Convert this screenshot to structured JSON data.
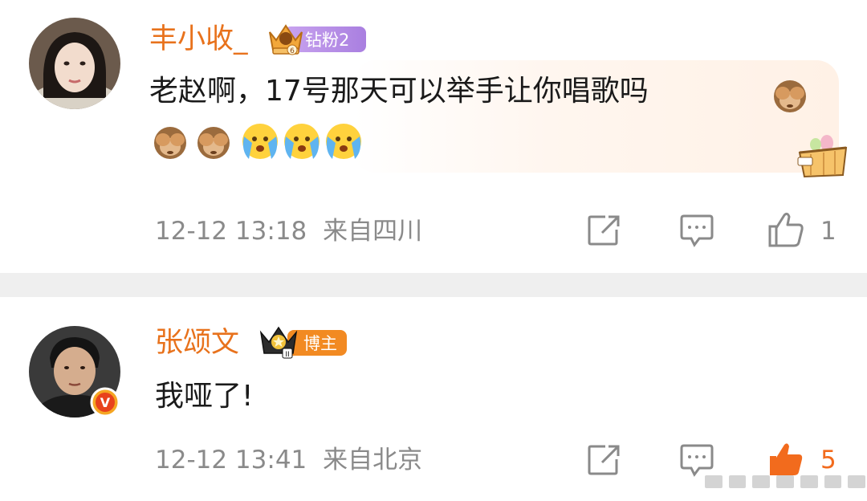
{
  "comments": [
    {
      "user": {
        "name": "丰小收_",
        "badge_level": "6",
        "badge_label": "钻粉2"
      },
      "text_line1": "老赵啊，17号那天可以举手让你唱歌吗",
      "meta": {
        "time": "12-12 13:18",
        "location": "来自四川"
      },
      "like_count": "1",
      "emojis": [
        "see-no-evil-monkey",
        "see-no-evil-monkey",
        "see-no-evil-monkey",
        "crying-face",
        "crying-face",
        "crying-face"
      ]
    },
    {
      "user": {
        "name": "张颂文",
        "badge_level": "II",
        "badge_label": "博主",
        "verified_mark": "V"
      },
      "text": "我哑了!",
      "meta": {
        "time": "12-12 13:41",
        "location": "来自北京"
      },
      "like_count": "5"
    }
  ],
  "colors": {
    "name": "#e8721c",
    "fan_badge": "#b48ae8",
    "blogger_badge": "#f28a22",
    "like_active": "#f26b1d"
  }
}
